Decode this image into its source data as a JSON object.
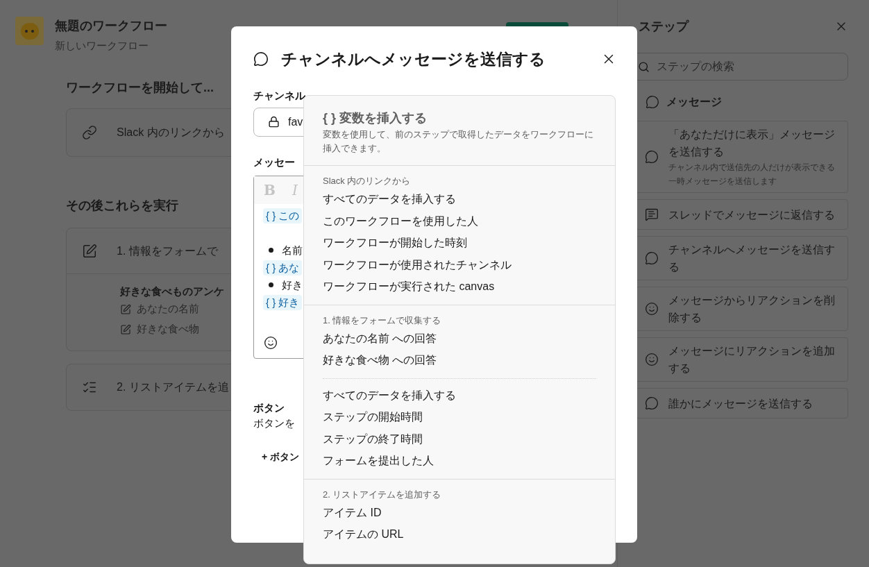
{
  "workflow": {
    "title": "無題のワークフロー",
    "subtitle": "新しいワークフロー"
  },
  "start_section": {
    "heading": "ワークフローを開始して...",
    "trigger": "Slack 内のリンクから"
  },
  "then_section": {
    "heading": "その後これらを実行",
    "steps": [
      {
        "kind": "form",
        "title": "1. 情報をフォームで",
        "form_title": "好きな食べものアンケ",
        "fields": [
          "あなたの名前",
          "好きな食べ物"
        ]
      },
      {
        "kind": "list",
        "title": "2. リストアイテムを追"
      }
    ]
  },
  "modal": {
    "title": "チャンネルへメッセージを送信する",
    "channel_label": "チャンネル",
    "channel_value": "fav",
    "message_label": "メッセー",
    "toolbar": [
      "B",
      "I"
    ],
    "editor_lines": [
      {
        "kind": "variable",
        "text": "この"
      },
      {
        "kind": "blank"
      },
      {
        "kind": "bullet",
        "text": "名前"
      },
      {
        "kind": "variable",
        "text": "あな"
      },
      {
        "kind": "bullet",
        "text": "好き"
      },
      {
        "kind": "variable",
        "text": "好き"
      }
    ],
    "variable_mark": "{ }",
    "buttons_label": "ボタン",
    "buttons_hint": "ボタンを",
    "add_button": "+ ボタン"
  },
  "variable_menu": {
    "title": "{ } 変数を挿入する",
    "description": "変数を使用して、前のステップで取得したデータをワークフローに挿入できます。",
    "sections": [
      {
        "title": "Slack 内のリンクから",
        "groups": [
          [
            "すべてのデータを挿入する",
            "このワークフローを使用した人",
            "ワークフローが開始した時刻",
            "ワークフローが使用されたチャンネル",
            "ワークフローが実行された canvas"
          ]
        ]
      },
      {
        "title": "1. 情報をフォームで収集する",
        "groups": [
          [
            "あなたの名前 への回答",
            "好きな食べ物 への回答"
          ],
          [
            "すべてのデータを挿入する",
            "ステップの開始時間",
            "ステップの終了時間",
            "フォームを提出した人"
          ]
        ]
      },
      {
        "title": "2. リストアイテムを追加する",
        "groups": [
          [
            "アイテム ID",
            "アイテムの URL"
          ]
        ]
      }
    ]
  },
  "steps_panel": {
    "title": "ステップ",
    "search_placeholder": "ステップの検索",
    "category": "メッセージ",
    "items": [
      {
        "kind": "message",
        "title": "「あなただけに表示」メッセージを送信する",
        "description": "チャンネル内で送信先の人だけが表示できる一時メッセージを送信します"
      },
      {
        "kind": "thread",
        "title": "スレッドでメッセージに返信する"
      },
      {
        "kind": "message",
        "title": "チャンネルへメッセージを送信する"
      },
      {
        "kind": "emoji",
        "title": "メッセージからリアクションを削除する"
      },
      {
        "kind": "emoji",
        "title": "メッセージにリアクションを追加する"
      },
      {
        "kind": "message",
        "title": "誰かにメッセージを送信する"
      }
    ]
  }
}
